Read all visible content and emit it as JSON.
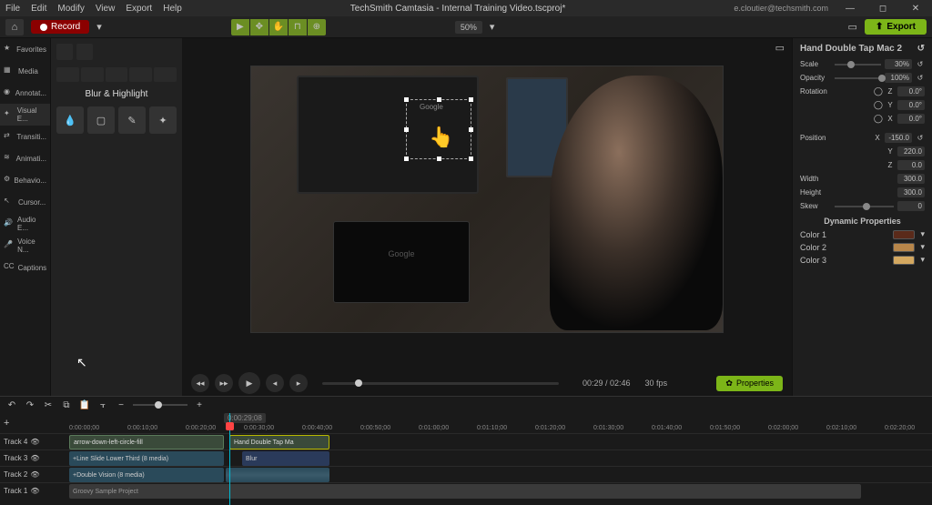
{
  "menubar": {
    "items": [
      "File",
      "Edit",
      "Modify",
      "View",
      "Export",
      "Help"
    ],
    "title": "TechSmith Camtasia - Internal Training Video.tscproj*",
    "user": "e.cloutier@techsmith.com"
  },
  "toolbar": {
    "record": "Record",
    "zoom": "50%",
    "export": "Export"
  },
  "sidebar": {
    "items": [
      {
        "label": "Favorites",
        "icon": "star"
      },
      {
        "label": "Media",
        "icon": "film"
      },
      {
        "label": "Annotat...",
        "icon": "bubble"
      },
      {
        "label": "Visual E...",
        "icon": "wand"
      },
      {
        "label": "Transiti...",
        "icon": "swap"
      },
      {
        "label": "Animati...",
        "icon": "motion"
      },
      {
        "label": "Behavio...",
        "icon": "gear"
      },
      {
        "label": "Cursor...",
        "icon": "cursor"
      },
      {
        "label": "Audio E...",
        "icon": "speaker"
      },
      {
        "label": "Voice N...",
        "icon": "mic"
      },
      {
        "label": "Captions",
        "icon": "cc"
      }
    ]
  },
  "effects_panel": {
    "title": "Blur & Highlight"
  },
  "playback": {
    "time": "00:29 / 02:46",
    "fps": "30 fps",
    "properties_btn": "Properties"
  },
  "properties": {
    "title": "Hand Double Tap Mac 2",
    "scale": {
      "label": "Scale",
      "value": "30%"
    },
    "opacity": {
      "label": "Opacity",
      "value": "100%"
    },
    "rotation": {
      "label": "Rotation",
      "z_label": "Z",
      "y_label": "Y",
      "x_label": "X",
      "z": "0.0°",
      "y": "0.0°",
      "x": "0.0°"
    },
    "position": {
      "label": "Position",
      "x_label": "X",
      "y_label": "Y",
      "z_label": "Z",
      "x": "-150.0",
      "y": "220.0",
      "z": "0.0"
    },
    "width": {
      "label": "Width",
      "value": "300.0"
    },
    "height": {
      "label": "Height",
      "value": "300.0"
    },
    "skew": {
      "label": "Skew",
      "value": "0"
    },
    "dynamic_title": "Dynamic Properties",
    "color1": {
      "label": "Color 1",
      "hex": "#5a2a1a"
    },
    "color2": {
      "label": "Color 2",
      "hex": "#b8864a"
    },
    "color3": {
      "label": "Color 3",
      "hex": "#d4a860"
    }
  },
  "timeline": {
    "timecode": "0:00:29;08",
    "ruler": [
      "0:00:00;00",
      "0:00:10;00",
      "0:00:20;00",
      "0:00:30;00",
      "0:00:40;00",
      "0:00:50;00",
      "0:01:00;00",
      "0:01:10;00",
      "0:01:20;00",
      "0:01:30;00",
      "0:01:40;00",
      "0:01:50;00",
      "0:02:00;00",
      "0:02:10;00",
      "0:02:20;00"
    ],
    "tracks": [
      {
        "name": "Track 4"
      },
      {
        "name": "Track 3"
      },
      {
        "name": "Track 2"
      },
      {
        "name": "Track 1"
      }
    ],
    "clips": {
      "t4a": "arrow-down-left-circle-fill",
      "t4b": "Hand Double Tap Ma",
      "t3a": "Line Slide Lower Third  (8 media)",
      "t3b": "Blur",
      "t2a": "Double Vision  (8 media)",
      "t1a": "Groovy Sample Project"
    }
  }
}
